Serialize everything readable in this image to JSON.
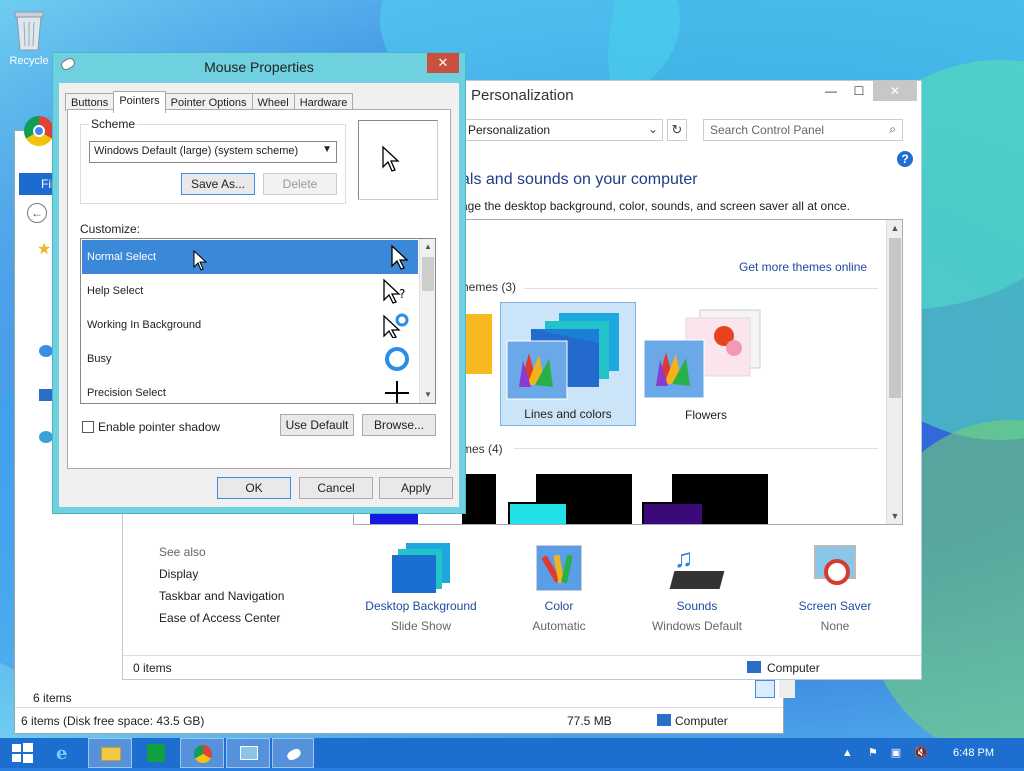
{
  "desktop": {
    "recycle_label": "Recycle"
  },
  "explorer": {
    "file_tab": "File",
    "items_count": "6 items",
    "status_left": "6 items (Disk free space: 43.5 GB)",
    "status_size": "77.5 MB",
    "status_location": "Computer"
  },
  "personalization": {
    "title": "Personalization",
    "address": "Personalization",
    "search_placeholder": "Search Control Panel",
    "heading": "als and sounds on your computer",
    "subheading": "age the desktop background, color, sounds, and screen saver all at once.",
    "get_more": "Get more themes online",
    "group1": "hemes (3)",
    "group2": "mes (4)",
    "themes": [
      {
        "label": "Lines and colors",
        "selected": true
      },
      {
        "label": "Flowers",
        "selected": false
      }
    ],
    "see_also": {
      "caption": "See also",
      "links": [
        "Display",
        "Taskbar and Navigation",
        "Ease of Access Center"
      ]
    },
    "bottom_items": [
      {
        "label": "Desktop Background",
        "sub": "Slide Show"
      },
      {
        "label": "Color",
        "sub": "Automatic"
      },
      {
        "label": "Sounds",
        "sub": "Windows Default"
      },
      {
        "label": "Screen Saver",
        "sub": "None"
      }
    ],
    "status_items": "0 items",
    "status_location": "Computer",
    "win_min": "—",
    "win_max": "☐",
    "win_close": "✕"
  },
  "mouse": {
    "title": "Mouse Properties",
    "close": "✕",
    "tabs": [
      "Buttons",
      "Pointers",
      "Pointer Options",
      "Wheel",
      "Hardware"
    ],
    "active_tab": "Pointers",
    "scheme_label": "Scheme",
    "scheme_value": "Windows Default (large) (system scheme)",
    "save_as": "Save As...",
    "delete": "Delete",
    "customize_label": "Customize:",
    "pointers": [
      {
        "label": "Normal Select",
        "selected": true
      },
      {
        "label": "Help Select",
        "selected": false
      },
      {
        "label": "Working In Background",
        "selected": false
      },
      {
        "label": "Busy",
        "selected": false
      },
      {
        "label": "Precision Select",
        "selected": false
      }
    ],
    "enable_shadow": "Enable pointer shadow",
    "use_default": "Use Default",
    "browse": "Browse...",
    "ok": "OK",
    "cancel": "Cancel",
    "apply": "Apply"
  },
  "taskbar": {
    "time": "6:48 PM"
  },
  "colors": {
    "accent": "#1e6ed0",
    "selection": "#3b87d8",
    "dialog_frame": "#6fd0e0"
  }
}
